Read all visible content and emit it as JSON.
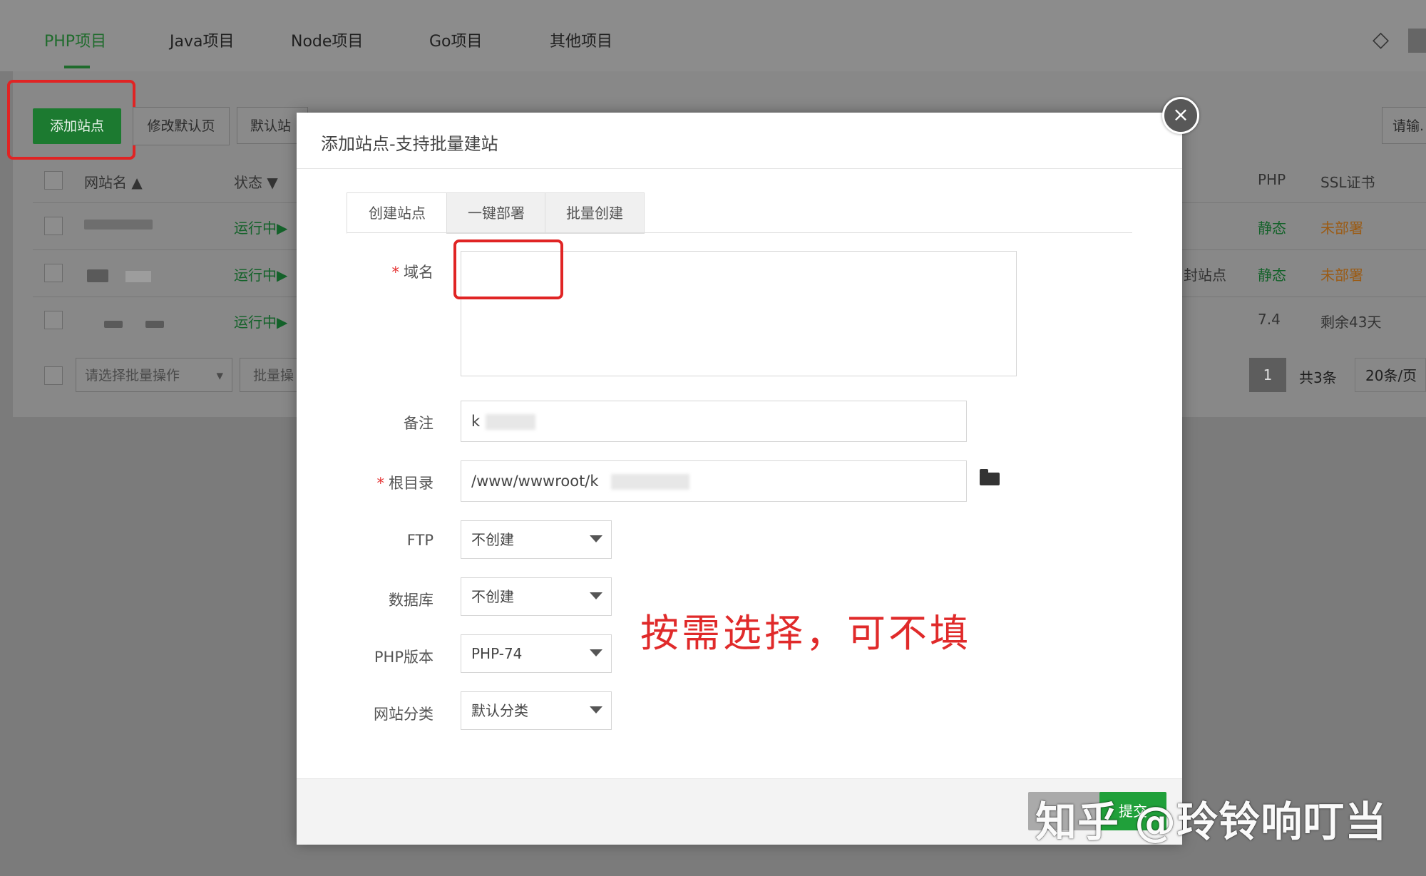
{
  "top_tabs": [
    "PHP项目",
    "Java项目",
    "Node项目",
    "Go项目",
    "其他项目"
  ],
  "toolbar": {
    "add_site": "添加站点",
    "edit_default_page": "修改默认页",
    "default_site": "默认站",
    "search_placeholder": "请输."
  },
  "table": {
    "headers": {
      "site_name": "网站名",
      "status": "状态",
      "php": "PHP",
      "ssl": "SSL证书"
    },
    "rows": [
      {
        "status": "运行中▶",
        "php": "静态",
        "ssl": "未部署",
        "note": ""
      },
      {
        "status": "运行中▶",
        "php": "静态",
        "ssl": "未部署",
        "note": "封站点"
      },
      {
        "status": "运行中▶",
        "php": "7.4",
        "ssl": "剩余43天",
        "note": ""
      }
    ],
    "batch_placeholder": "请选择批量操作",
    "batch_button": "批量操",
    "pager": {
      "current_page": "1",
      "total": "共3条",
      "per_page": "20条/页"
    }
  },
  "modal": {
    "title": "添加站点-支持批量建站",
    "tabs": [
      "创建站点",
      "一键部署",
      "批量创建"
    ],
    "fields": {
      "domain_label": "域名",
      "remark_label": "备注",
      "remark_value": "k",
      "root_label": "根目录",
      "root_value": "/www/wwwroot/k",
      "ftp_label": "FTP",
      "ftp_value": "不创建",
      "db_label": "数据库",
      "db_value": "不创建",
      "php_label": "PHP版本",
      "php_value": "PHP-74",
      "category_label": "网站分类",
      "category_value": "默认分类"
    },
    "required_mark": "*",
    "close_symbol": "×",
    "submit_partial": "提交"
  },
  "annotation": "按需选择，可不填",
  "watermark": "知乎 @玲铃响叮当",
  "colors": {
    "accent_green": "#20a03a",
    "annotation_red": "#e02a2a"
  }
}
